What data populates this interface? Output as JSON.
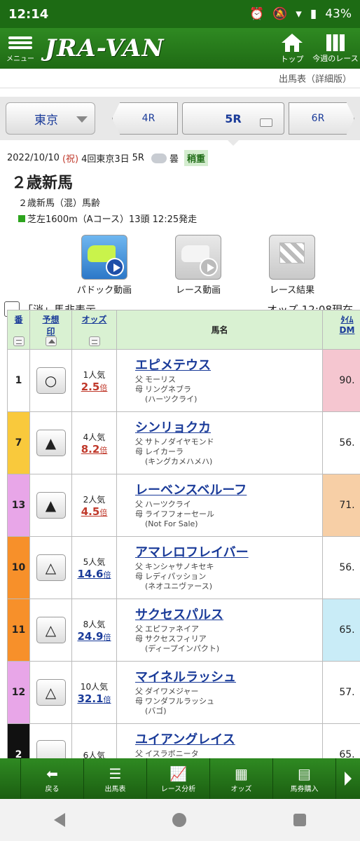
{
  "status": {
    "time": "12:14",
    "battery": "43%"
  },
  "header": {
    "menu_label": "メニュー",
    "logo": "JRA-VAN",
    "top_label": "トップ",
    "week_label": "今週のレース"
  },
  "subheader": "出馬表（詳細版）",
  "selector": {
    "venue": "東京",
    "prev_race": "4R",
    "current_race": "5R",
    "next_race": "6R"
  },
  "race": {
    "date": "2022/10/10",
    "holiday": "(祝)",
    "meeting": "4回東京3日",
    "race_no": "5R",
    "weather": "曇",
    "going": "稍重",
    "name": "２歳新馬",
    "conditions": "２歳新馬（混）馬齢",
    "distance_info": "芝左1600m（Aコース）13頭 12:25発走"
  },
  "media": {
    "paddock": "パドック動画",
    "video": "レース動画",
    "result": "レース結果"
  },
  "options": {
    "hide_label": "「消」馬非表示",
    "odds_time": "オッズ 12:08現在"
  },
  "table": {
    "headers": {
      "num": "番",
      "mark_top": "予想",
      "mark_bottom": "印",
      "odds": "オッズ",
      "name": "馬名",
      "tdm_top": "ﾀｲﾑ",
      "tdm_bottom": "DM"
    },
    "rows": [
      {
        "num": "1",
        "mark": "○",
        "rank": "1人気",
        "odds": "2.5",
        "bai": "倍",
        "name": "エピメテウス",
        "sire_label": "父",
        "sire": "モーリス",
        "dam_label": "母",
        "dam": "リングネブラ",
        "bms": "(ハーツクライ)",
        "tdm": "90."
      },
      {
        "num": "7",
        "mark": "▲",
        "rank": "4人気",
        "odds": "8.2",
        "bai": "倍",
        "name": "シンリョクカ",
        "sire_label": "父",
        "sire": "サトノダイヤモンド",
        "dam_label": "母",
        "dam": "レイカーラ",
        "bms": "(キングカメハメハ)",
        "tdm": "56."
      },
      {
        "num": "13",
        "mark": "▲",
        "rank": "2人気",
        "odds": "4.5",
        "bai": "倍",
        "name": "レーベンスベルーフ",
        "sire_label": "父",
        "sire": "ハーツクライ",
        "dam_label": "母",
        "dam": "ライフフォーセール",
        "bms": "(Not For Sale)",
        "tdm": "71."
      },
      {
        "num": "10",
        "mark": "△",
        "rank": "5人気",
        "odds": "14.6",
        "bai": "倍",
        "name": "アマレロフレイバー",
        "sire_label": "父",
        "sire": "キンシャサノキセキ",
        "dam_label": "母",
        "dam": "レディパッション",
        "bms": "(ネオユニヴァース)",
        "tdm": "56."
      },
      {
        "num": "11",
        "mark": "△",
        "rank": "8人気",
        "odds": "24.9",
        "bai": "倍",
        "name": "サクセスパルス",
        "sire_label": "父",
        "sire": "エピファネイア",
        "dam_label": "母",
        "dam": "サクセスフィリア",
        "bms": "(ディープインパクト)",
        "tdm": "65."
      },
      {
        "num": "12",
        "mark": "△",
        "rank": "10人気",
        "odds": "32.1",
        "bai": "倍",
        "name": "マイネルラッシュ",
        "sire_label": "父",
        "sire": "ダイワメジャー",
        "dam_label": "母",
        "dam": "ワンダフルラッシュ",
        "bms": "(バゴ)",
        "tdm": "57."
      },
      {
        "num": "2",
        "mark": "",
        "rank": "6人気",
        "odds": "",
        "bai": "",
        "name": "ユイアングレイス",
        "sire_label": "父",
        "sire": "イスラボニータ",
        "dam_label": "",
        "dam": "",
        "bms": "",
        "tdm": "65."
      }
    ]
  },
  "colors": {
    "row_nums": [
      "#ffffff",
      "#f9c93c",
      "#e8a6e8",
      "#f7902a",
      "#f7902a",
      "#e8a6e8",
      "#111111"
    ],
    "row_num_text": [
      "#222222",
      "#222222",
      "#222222",
      "#222222",
      "#222222",
      "#222222",
      "#ffffff"
    ],
    "tdm": [
      "#f5c6d0",
      "#ffffff",
      "#f7cfa6",
      "#ffffff",
      "#c9ecf7",
      "#ffffff",
      "#ffffff"
    ],
    "odds_hot": [
      true,
      true,
      true,
      false,
      false,
      false,
      false
    ]
  },
  "bottomnav": {
    "back": "戻る",
    "card": "出馬表",
    "analysis": "レース分析",
    "odds": "オッズ",
    "buy": "馬券購入"
  }
}
